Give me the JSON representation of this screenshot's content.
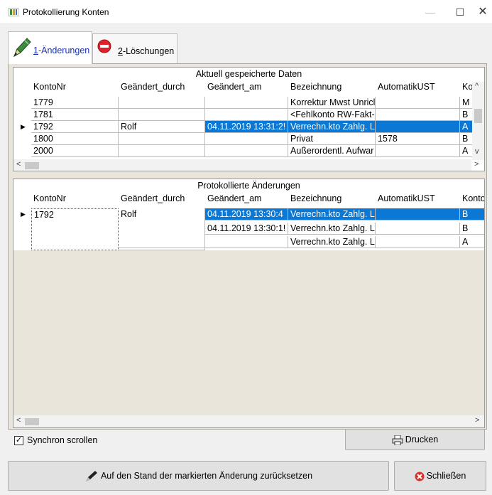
{
  "window": {
    "title": "Protokollierung Konten",
    "min_glyph": "—",
    "max_glyph": "☐",
    "close_glyph": "✕"
  },
  "tabs": [
    {
      "accel": "1",
      "rest": "-Änderungen",
      "icon": "pencil-icon"
    },
    {
      "accel": "2",
      "rest": "-Löschungen",
      "icon": "no-entry-icon"
    }
  ],
  "grid_top": {
    "title": "Aktuell gespeicherte Daten",
    "columns": [
      "KontoNr",
      "Geändert_durch",
      "Geändert_am",
      "Bezeichnung",
      "AutomatikUST",
      "Kor"
    ],
    "rows": [
      [
        "1779",
        "",
        "",
        "Korrektur Mwst Unricl",
        "",
        "M"
      ],
      [
        "1781",
        "",
        "",
        "<Fehlkonto RW-Fakt-",
        "",
        "B"
      ],
      [
        "1792",
        "Rolf",
        "04.11.2019 13:31:2!",
        "Verrechn.kto Zahlg. L",
        "",
        "A"
      ],
      [
        "1800",
        "",
        "",
        "Privat",
        "1578",
        "B"
      ],
      [
        "2000",
        "",
        "",
        "Außerordentl. Aufwar",
        "",
        "A"
      ]
    ],
    "selected_row": 2
  },
  "grid_bottom": {
    "title": "Protokollierte Änderungen",
    "columns": [
      "KontoNr",
      "Geändert_durch",
      "Geändert_am",
      "Bezeichnung",
      "AutomatikUST",
      "Konto"
    ],
    "rows": [
      [
        "1792",
        "Rolf",
        "04.11.2019 13:30:4",
        "Verrechn.kto Zahlg. L",
        "",
        "B"
      ],
      [
        "",
        "",
        "04.11.2019 13:30:1!",
        "Verrechn.kto Zahlg. L",
        "",
        "B"
      ],
      [
        "",
        "",
        "",
        "Verrechn.kto Zahlg. L",
        "",
        "A"
      ]
    ],
    "selected_row": 0
  },
  "sync_scroll": {
    "label": "Synchron scrollen",
    "checked": true,
    "mark": "✓"
  },
  "buttons": {
    "print": "Drucken",
    "reset": "Auf den Stand der markierten Änderung zurücksetzen",
    "close": "Schließen"
  },
  "colors": {
    "selection": "#0a78d4",
    "panel_bg": "#e9e5db",
    "close_icon": "#d9302c"
  }
}
